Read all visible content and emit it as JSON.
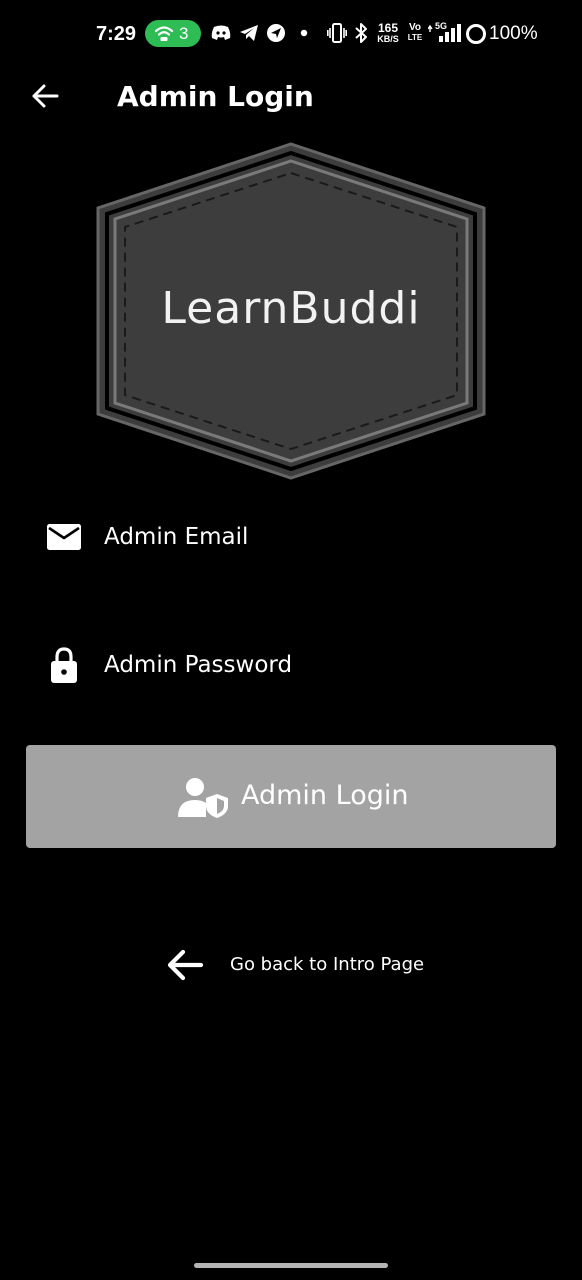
{
  "status_bar": {
    "time": "7:29",
    "hotspot_count": "3",
    "net_speed_value": "165",
    "net_speed_unit": "KB/S",
    "volte_top": "Vo",
    "volte_bottom": "LTE",
    "network_type": "5G",
    "battery": "100%"
  },
  "app_bar": {
    "title": "Admin Login"
  },
  "logo": {
    "text": "LearnBuddi"
  },
  "form": {
    "email_placeholder": "Admin Email",
    "password_placeholder": "Admin Password"
  },
  "login_button": {
    "label": "Admin Login"
  },
  "go_back": {
    "label": "Go back to Intro Page"
  },
  "colors": {
    "background": "#000000",
    "button": "#a3a3a3",
    "hotspot": "#2ebd54",
    "logo_fill": "#3d3d3d"
  }
}
